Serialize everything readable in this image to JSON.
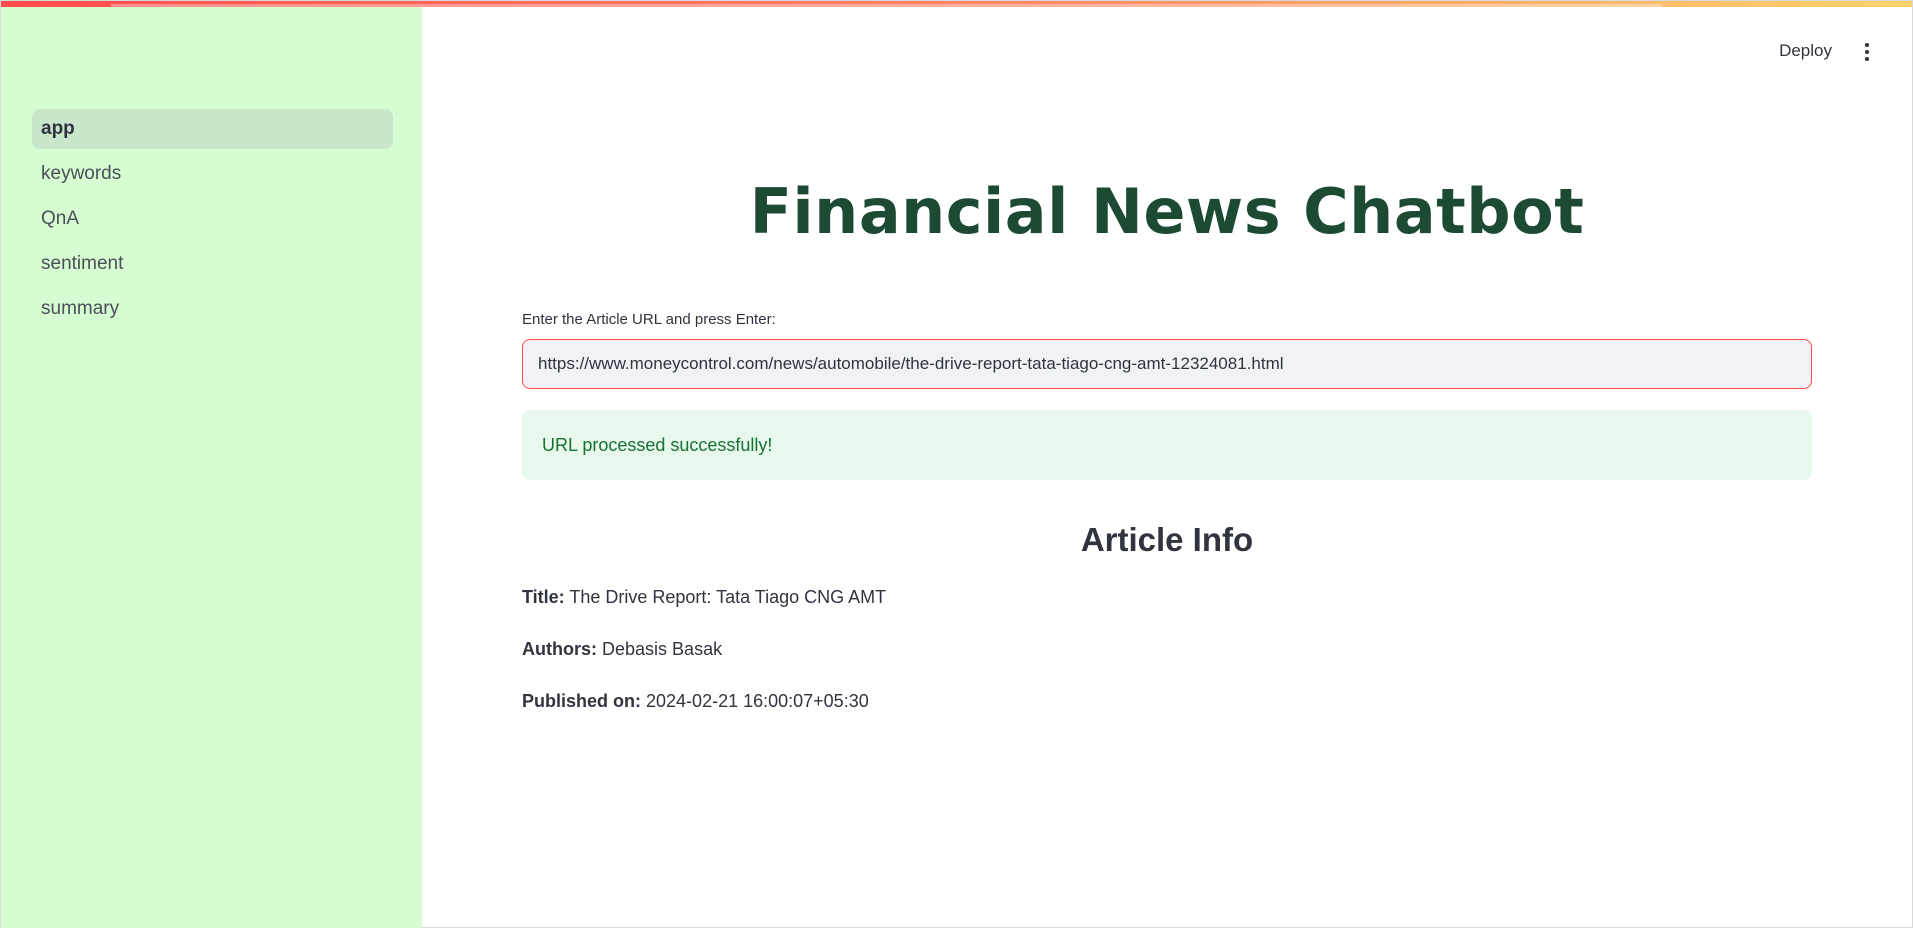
{
  "sidebar": {
    "items": [
      {
        "label": "app",
        "active": true
      },
      {
        "label": "keywords"
      },
      {
        "label": "QnA"
      },
      {
        "label": "sentiment"
      },
      {
        "label": "summary"
      }
    ]
  },
  "toolbar": {
    "deploy_label": "Deploy",
    "menu_icon": "vertical-dots-icon"
  },
  "main": {
    "title": "Financial News Chatbot",
    "url_label": "Enter the Article URL and press Enter:",
    "url_value": "https://www.moneycontrol.com/news/automobile/the-drive-report-tata-tiago-cng-amt-12324081.html",
    "success_message": "URL processed successfully!",
    "article_info_heading": "Article Info",
    "article": {
      "title_label": "Title:",
      "title_value": "The Drive Report: Tata Tiago CNG AMT",
      "authors_label": "Authors:",
      "authors_value": "Debasis Basak",
      "published_label": "Published on:",
      "published_value": "2024-02-21 16:00:07+05:30"
    }
  },
  "colors": {
    "sidebar_bg": "#d6fdd2",
    "title": "#1d4a32",
    "accent": "#ff4b4b",
    "success_bg": "#e8f8ec",
    "success_text": "#177233"
  }
}
